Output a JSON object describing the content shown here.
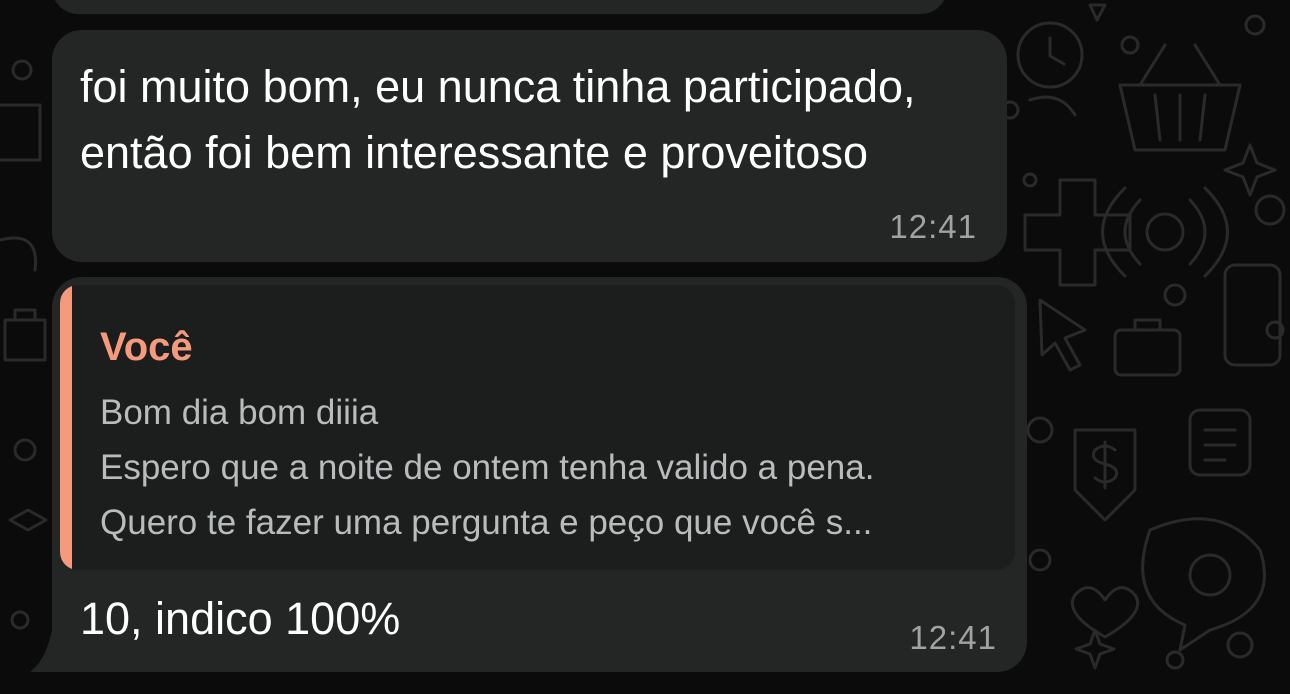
{
  "conversation": {
    "message_1": {
      "text": "foi muito bom, eu nunca tinha participado, então foi bem interessante e proveitoso",
      "time": "12:41"
    },
    "message_2": {
      "quoted": {
        "author": "Você",
        "line_1": "Bom dia bom diiia",
        "line_2": "Espero que a noite de ontem tenha valido a pena.",
        "line_3": "Quero te fazer uma pergunta e peço que você s..."
      },
      "text": "10, indico 100%",
      "time": "12:41"
    }
  },
  "colors": {
    "background": "#0b0b0b",
    "bubble": "#242626",
    "quote_background": "#1c1e1e",
    "quote_accent": "#f59a7c",
    "timestamp": "#a0a3a3",
    "quoted_text": "#b9bcbc"
  },
  "icons": [
    "chat-wallpaper-doodle-icon"
  ]
}
